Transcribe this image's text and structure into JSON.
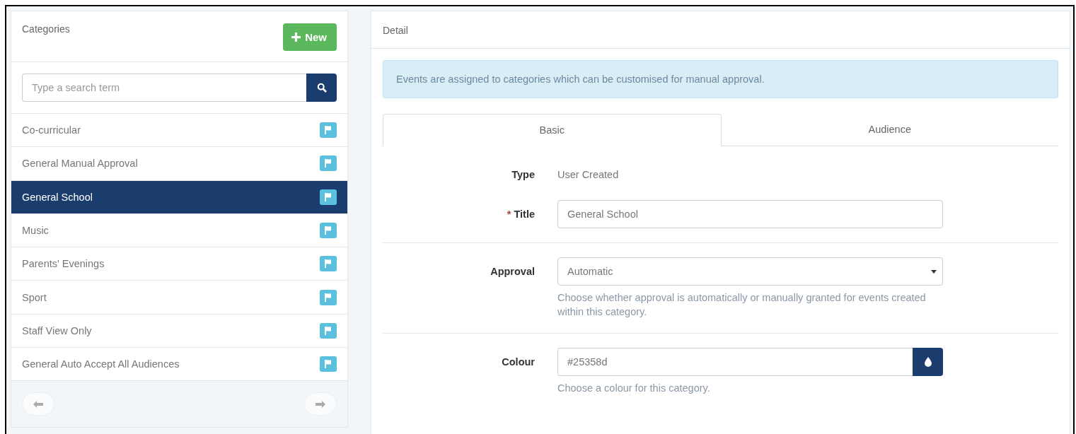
{
  "categories": {
    "title": "Categories",
    "new_button": "New",
    "search": {
      "placeholder": "Type a search term"
    },
    "items": [
      {
        "label": "Co-curricular",
        "selected": false
      },
      {
        "label": "General Manual Approval",
        "selected": false
      },
      {
        "label": "General School",
        "selected": true
      },
      {
        "label": "Music",
        "selected": false
      },
      {
        "label": "Parents' Evenings",
        "selected": false
      },
      {
        "label": "Sport",
        "selected": false
      },
      {
        "label": "Staff View Only",
        "selected": false
      },
      {
        "label": "General Auto Accept All Audiences",
        "selected": false
      }
    ]
  },
  "detail": {
    "title": "Detail",
    "alert": "Events are assigned to categories which can be customised for manual approval.",
    "tabs": [
      {
        "label": "Basic",
        "selected": true
      },
      {
        "label": "Audience",
        "selected": false
      }
    ],
    "form_groups": [
      [
        {
          "kind": "text",
          "label": "Type",
          "value": "User Created"
        },
        {
          "kind": "input",
          "label": "Title",
          "marker": "*",
          "value": "General School"
        }
      ],
      [
        {
          "kind": "select",
          "label": "Approval",
          "value": "Automatic",
          "help": "Choose whether approval is automatically or manually granted for events created within this category."
        }
      ],
      [
        {
          "kind": "color",
          "label": "Colour",
          "value": "#25358d",
          "help": "Choose a colour for this category."
        }
      ]
    ]
  }
}
